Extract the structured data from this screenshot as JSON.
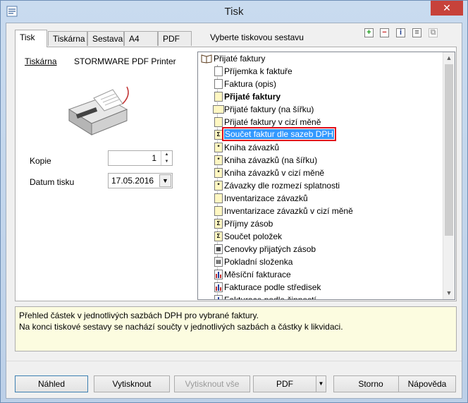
{
  "window": {
    "title": "Tisk",
    "close_symbol": "✕"
  },
  "tabs": [
    {
      "label": "Tisk",
      "active": true
    },
    {
      "label": "Tiskárna",
      "active": false
    },
    {
      "label": "Sestava",
      "active": false
    },
    {
      "label": "A4",
      "active": false
    },
    {
      "label": "PDF",
      "active": false
    }
  ],
  "hint": "Vyberte tiskovou sestavu",
  "toolbar_icons": [
    "add-icon",
    "remove-icon",
    "info-icon",
    "properties-icon",
    "copy-icon"
  ],
  "printer": {
    "label": "Tiskárna",
    "name": "STORMWARE PDF Printer"
  },
  "copies": {
    "label": "Kopie",
    "value": "1"
  },
  "print_date": {
    "label": "Datum tisku",
    "value": "17.05.2016"
  },
  "tree": {
    "root": "Přijaté faktury",
    "items": [
      {
        "label": "Příjemka k faktuře",
        "icon": "page-icon"
      },
      {
        "label": "Faktura (opis)",
        "icon": "page-icon"
      },
      {
        "label": "Přijaté faktury",
        "icon": "yellow-page-icon",
        "bold": true
      },
      {
        "label": "Přijaté faktury (na šířku)",
        "icon": "landscape-page-icon"
      },
      {
        "label": "Přijaté faktury v cizí měně",
        "icon": "yellow-page-icon"
      },
      {
        "label": "Součet faktur dle sazeb DPH",
        "icon": "sum-icon",
        "selected": true
      },
      {
        "label": "Kniha závazků",
        "icon": "book-icon"
      },
      {
        "label": "Kniha závazků (na šířku)",
        "icon": "book-icon"
      },
      {
        "label": "Kniha závazků v cizí měně",
        "icon": "book-icon"
      },
      {
        "label": "Závazky dle rozmezí splatnosti",
        "icon": "book-icon"
      },
      {
        "label": "Inventarizace závazků",
        "icon": "yellow-page-icon"
      },
      {
        "label": "Inventarizace závazků v cizí měně",
        "icon": "yellow-page-icon"
      },
      {
        "label": "Příjmy zásob",
        "icon": "sum-icon"
      },
      {
        "label": "Součet položek",
        "icon": "sum-icon"
      },
      {
        "label": "Cenovky přijatých zásob",
        "icon": "grid-icon"
      },
      {
        "label": "Pokladní složenka",
        "icon": "receipt-icon"
      },
      {
        "label": "Měsíční fakturace",
        "icon": "bar-chart-icon"
      },
      {
        "label": "Fakturace podle středisek",
        "icon": "bar-chart-icon"
      },
      {
        "label": "Fakturace podle činností",
        "icon": "bar-chart-icon"
      }
    ]
  },
  "description": [
    "Přehled částek v jednotlivých sazbách DPH pro vybrané faktury.",
    "Na konci tiskové sestavy se nachází součty v jednotlivých sazbách a částky k likvidaci."
  ],
  "buttons": {
    "preview": "Náhled",
    "print": "Vytisknout",
    "print_all": "Vytisknout vše",
    "pdf": "PDF",
    "cancel": "Storno",
    "help": "Nápověda"
  },
  "colors": {
    "selection": "#3399ff",
    "selection_outline": "#e0101c",
    "description_bg": "#fcfce0"
  }
}
